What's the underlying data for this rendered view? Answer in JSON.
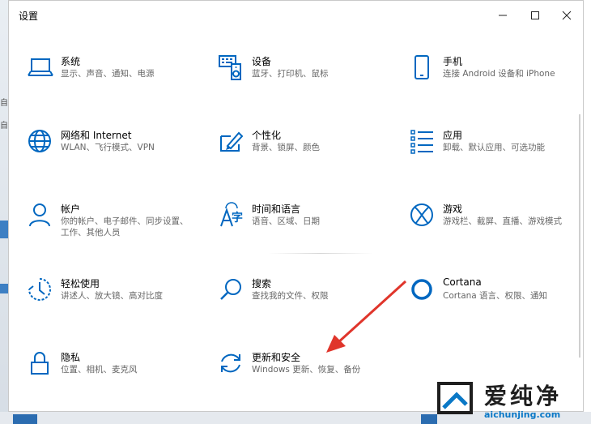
{
  "window": {
    "title": "设置"
  },
  "controls": {
    "minimize": "—",
    "maximize": "☐",
    "close": "✕"
  },
  "tiles": [
    {
      "name": "系统",
      "desc": "显示、声音、通知、电源",
      "icon": "laptop-icon"
    },
    {
      "name": "设备",
      "desc": "蓝牙、打印机、鼠标",
      "icon": "devices-icon"
    },
    {
      "name": "手机",
      "desc": "连接 Android 设备和 iPhone",
      "icon": "phone-icon"
    },
    {
      "name": "网络和 Internet",
      "desc": "WLAN、飞行模式、VPN",
      "icon": "globe-icon"
    },
    {
      "name": "个性化",
      "desc": "背景、锁屏、颜色",
      "icon": "paint-icon"
    },
    {
      "name": "应用",
      "desc": "卸载、默认应用、可选功能",
      "icon": "apps-list-icon"
    },
    {
      "name": "帐户",
      "desc": "你的帐户、电子邮件、同步设置、工作、其他人员",
      "icon": "person-icon"
    },
    {
      "name": "时间和语言",
      "desc": "语音、区域、日期",
      "icon": "time-language-icon"
    },
    {
      "name": "游戏",
      "desc": "游戏栏、截屏、直播、游戏模式",
      "icon": "xbox-icon"
    },
    {
      "name": "轻松使用",
      "desc": "讲述人、放大镜、高对比度",
      "icon": "ease-of-access-icon"
    },
    {
      "name": "搜索",
      "desc": "查找我的文件、权限",
      "icon": "search-icon"
    },
    {
      "name": "Cortana",
      "desc": "Cortana 语言、权限、通知",
      "icon": "cortana-icon"
    },
    {
      "name": "隐私",
      "desc": "位置、相机、麦克风",
      "icon": "lock-icon"
    },
    {
      "name": "更新和安全",
      "desc": "Windows 更新、恢复、备份",
      "icon": "update-icon"
    }
  ],
  "watermark": {
    "text": "爱纯净",
    "url": "aichunjing.com"
  },
  "colors": {
    "accent": "#0067c0",
    "arrow": "#e0352b"
  }
}
